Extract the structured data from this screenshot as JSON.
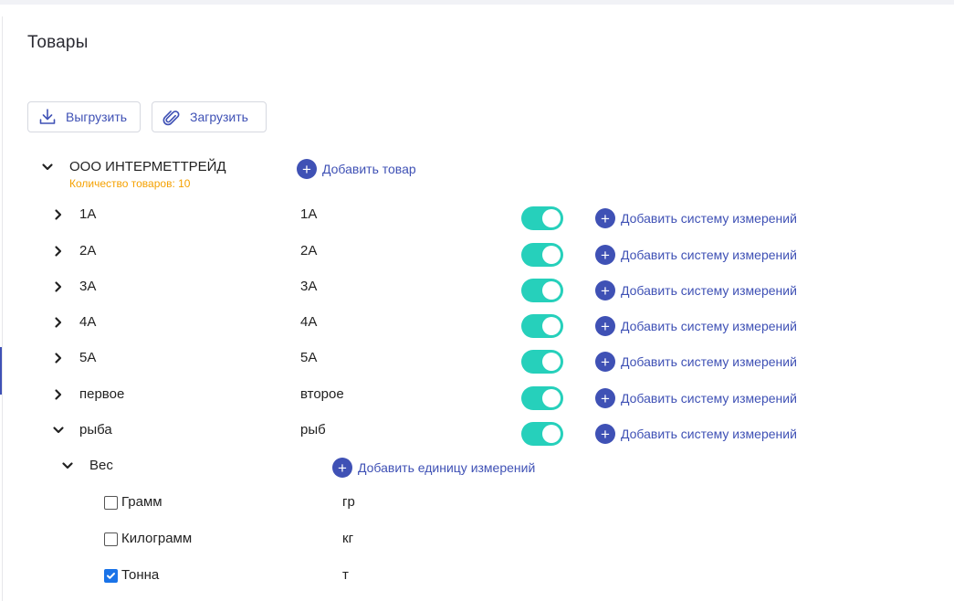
{
  "page": {
    "title": "Товары"
  },
  "toolbar": {
    "export_label": "Выгрузить",
    "import_label": "Загрузить"
  },
  "organization": {
    "name": "ООО ИНТЕРМЕТТРЕЙД",
    "count_label": "Количество товаров: 10",
    "add_product_label": "Добавить товар"
  },
  "products": [
    {
      "name": "1А",
      "code": "1А",
      "enabled": true,
      "add_label": "Добавить систему измерений",
      "expanded": false
    },
    {
      "name": "2А",
      "code": "2А",
      "enabled": true,
      "add_label": "Добавить систему измерений",
      "expanded": false
    },
    {
      "name": "3А",
      "code": "3А",
      "enabled": true,
      "add_label": "Добавить систему измерений",
      "expanded": false
    },
    {
      "name": "4А",
      "code": "4А",
      "enabled": true,
      "add_label": "Добавить систему измерений",
      "expanded": false
    },
    {
      "name": "5А",
      "code": "5А",
      "enabled": true,
      "add_label": "Добавить систему измерений",
      "expanded": false
    },
    {
      "name": "первое",
      "code": "второе",
      "enabled": true,
      "add_label": "Добавить систему измерений",
      "expanded": false
    },
    {
      "name": "рыба",
      "code": "рыб",
      "enabled": true,
      "add_label": "Добавить систему измерений",
      "expanded": true
    }
  ],
  "measure_system": {
    "name": "Вес",
    "add_unit_label": "Добавить единицу измерений",
    "units": [
      {
        "name": "Грамм",
        "abbr": "гр",
        "checked": false
      },
      {
        "name": "Килограмм",
        "abbr": "кг",
        "checked": false
      },
      {
        "name": "Тонна",
        "abbr": "т",
        "checked": true
      }
    ]
  },
  "colors": {
    "accent": "#3f51b5",
    "toggle_on": "#26d0bb",
    "count_text": "#f5a100",
    "checkbox_on": "#1a73e8"
  },
  "icons": {
    "export": "download-icon",
    "import": "paperclip-icon",
    "expand": "chevron-down-icon",
    "collapse": "chevron-right-icon",
    "add": "plus-circle-icon"
  }
}
